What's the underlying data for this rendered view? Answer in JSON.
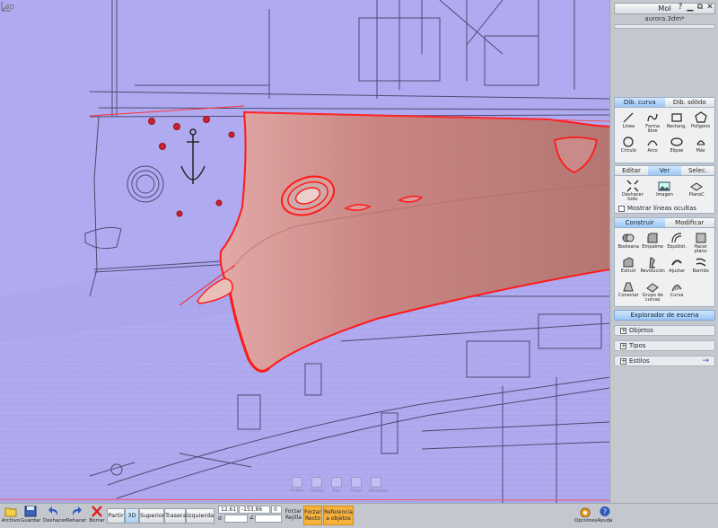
{
  "viewport": {
    "label": "3D",
    "nav_controls": [
      "Pnlrez",
      "Zoom",
      "Pan",
      "Girar",
      "Resetear"
    ]
  },
  "window": {
    "title": "MoI",
    "filename": "aurora.3dm*",
    "buttons": [
      "?",
      "minimize",
      "maximize",
      "close"
    ]
  },
  "draw": {
    "tabs": [
      "Dib. curva",
      "Dib. sólido"
    ],
    "active_tab": 0,
    "tools": [
      {
        "label": "Línea",
        "icon": "line-icon"
      },
      {
        "label": "Forma libre",
        "icon": "freeform-icon"
      },
      {
        "label": "Rectang.",
        "icon": "rectangle-icon"
      },
      {
        "label": "Polígono",
        "icon": "polygon-icon"
      },
      {
        "label": "Círculo",
        "icon": "circle-icon"
      },
      {
        "label": "Arco",
        "icon": "arc-icon"
      },
      {
        "label": "Elipse",
        "icon": "ellipse-icon"
      },
      {
        "label": "Más",
        "icon": "more-icon"
      }
    ]
  },
  "view": {
    "tabs": [
      "Editar",
      "Ver",
      "Selec."
    ],
    "active_tab": 1,
    "tools": [
      {
        "label": "Deshacer todo",
        "icon": "reset-view-icon"
      },
      {
        "label": "Imagen",
        "icon": "image-icon"
      },
      {
        "label": "PlanoC",
        "icon": "cplane-icon"
      }
    ],
    "checkbox_label": "Mostrar líneas ocultas"
  },
  "construct": {
    "tabs": [
      "Construir",
      "Modificar"
    ],
    "active_tab": 0,
    "tools": [
      {
        "label": "Booleana",
        "icon": "boolean-icon"
      },
      {
        "label": "Empalme",
        "icon": "fillet-icon"
      },
      {
        "label": "Equidist.",
        "icon": "offset-icon"
      },
      {
        "label": "Hacer plano",
        "icon": "planar-icon"
      },
      {
        "label": "Extruir",
        "icon": "extrude-icon"
      },
      {
        "label": "Revolución",
        "icon": "revolve-icon"
      },
      {
        "label": "Ajustar",
        "icon": "sweep-icon"
      },
      {
        "label": "Barrido",
        "icon": "loft-icon"
      },
      {
        "label": "Conectar",
        "icon": "connect-icon"
      },
      {
        "label": "Grupo de curvas",
        "icon": "network-icon"
      },
      {
        "label": "Curva",
        "icon": "curve-icon"
      }
    ]
  },
  "explorer": {
    "button": "Explorador de escena",
    "items": [
      "Objetos",
      "Tipos",
      "Estilos"
    ]
  },
  "bottombar": {
    "file": [
      {
        "label": "Archivo",
        "icon": "folder-icon"
      },
      {
        "label": "Guardar",
        "icon": "save-icon"
      },
      {
        "label": "Deshacer",
        "icon": "undo-icon"
      },
      {
        "label": "Rehacer",
        "icon": "redo-icon"
      },
      {
        "label": "Borrar",
        "icon": "delete-icon"
      }
    ],
    "views": [
      "Partir",
      "3D",
      "Superior",
      "Trasera",
      "Izquierda"
    ],
    "active_view": 1,
    "coords": {
      "x": "12.61",
      "y": "-153.86",
      "z": "0",
      "d_label": "d",
      "angle_label": "∠"
    },
    "snaps": [
      {
        "label": "Forzar Rejilla",
        "on": false
      },
      {
        "label": "Forzar Recto",
        "on": true
      },
      {
        "label": "Referencia a objetos",
        "on": true
      }
    ],
    "right": [
      {
        "label": "Opciones",
        "icon": "options-icon"
      },
      {
        "label": "Ayuda",
        "icon": "help-icon"
      }
    ]
  },
  "colors": {
    "viewport_bg": "#b0aaf0",
    "hull": "#c98a8a",
    "selection": "#ff1010",
    "accent_tab": "#9cc7f4",
    "snap_on": "#f6b23c"
  }
}
